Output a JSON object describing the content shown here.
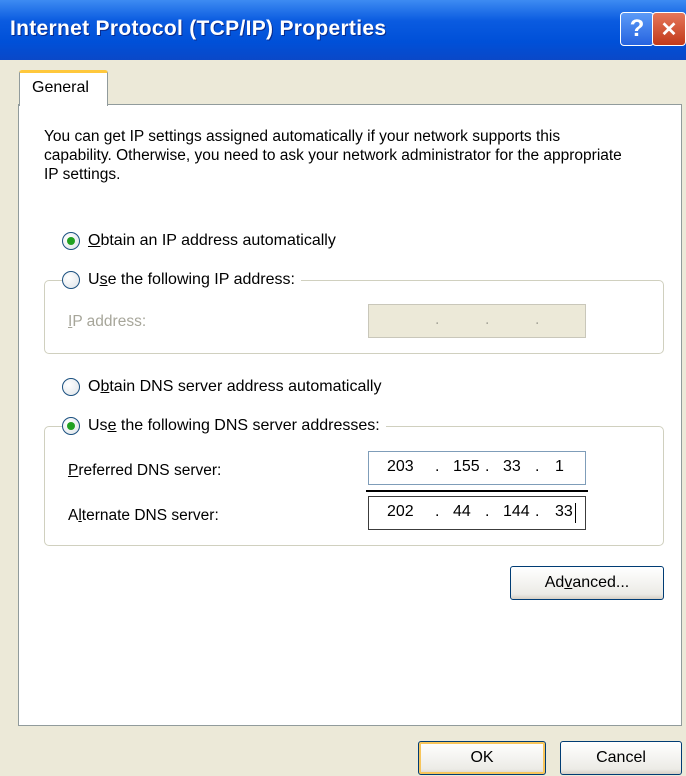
{
  "window": {
    "title": "Internet Protocol (TCP/IP) Properties",
    "help_glyph": "?",
    "close_glyph": "✕"
  },
  "tabs": {
    "general": "General"
  },
  "intro_text": "You can get IP settings assigned automatically if your network supports this capability. Otherwise, you need to ask your network administrator for the appropriate IP settings.",
  "ip_section": {
    "obtain_auto": {
      "pre": "",
      "key": "O",
      "post": "btain an IP address automatically",
      "selected": true
    },
    "use_following": {
      "pre": "U",
      "key": "s",
      "post": "e the following IP address:",
      "selected": false
    },
    "ip_address_label": {
      "pre": "",
      "key": "I",
      "post": "P address:"
    }
  },
  "dns_section": {
    "obtain_auto": {
      "pre": "O",
      "key": "b",
      "post": "tain DNS server address automatically",
      "selected": false
    },
    "use_following": {
      "pre": "Us",
      "key": "e",
      "post": " the following DNS server addresses:",
      "selected": true
    },
    "preferred": {
      "label": {
        "pre": "",
        "key": "P",
        "post": "referred DNS server:"
      },
      "octets": [
        "203",
        "155",
        "33",
        "1"
      ]
    },
    "alternate": {
      "label": {
        "pre": "A",
        "key": "l",
        "post": "ternate DNS server:"
      },
      "octets": [
        "202",
        "44",
        "144",
        "33"
      ]
    }
  },
  "buttons": {
    "advanced": {
      "pre": "Ad",
      "key": "v",
      "post": "anced..."
    },
    "ok": "OK",
    "cancel": "Cancel"
  }
}
